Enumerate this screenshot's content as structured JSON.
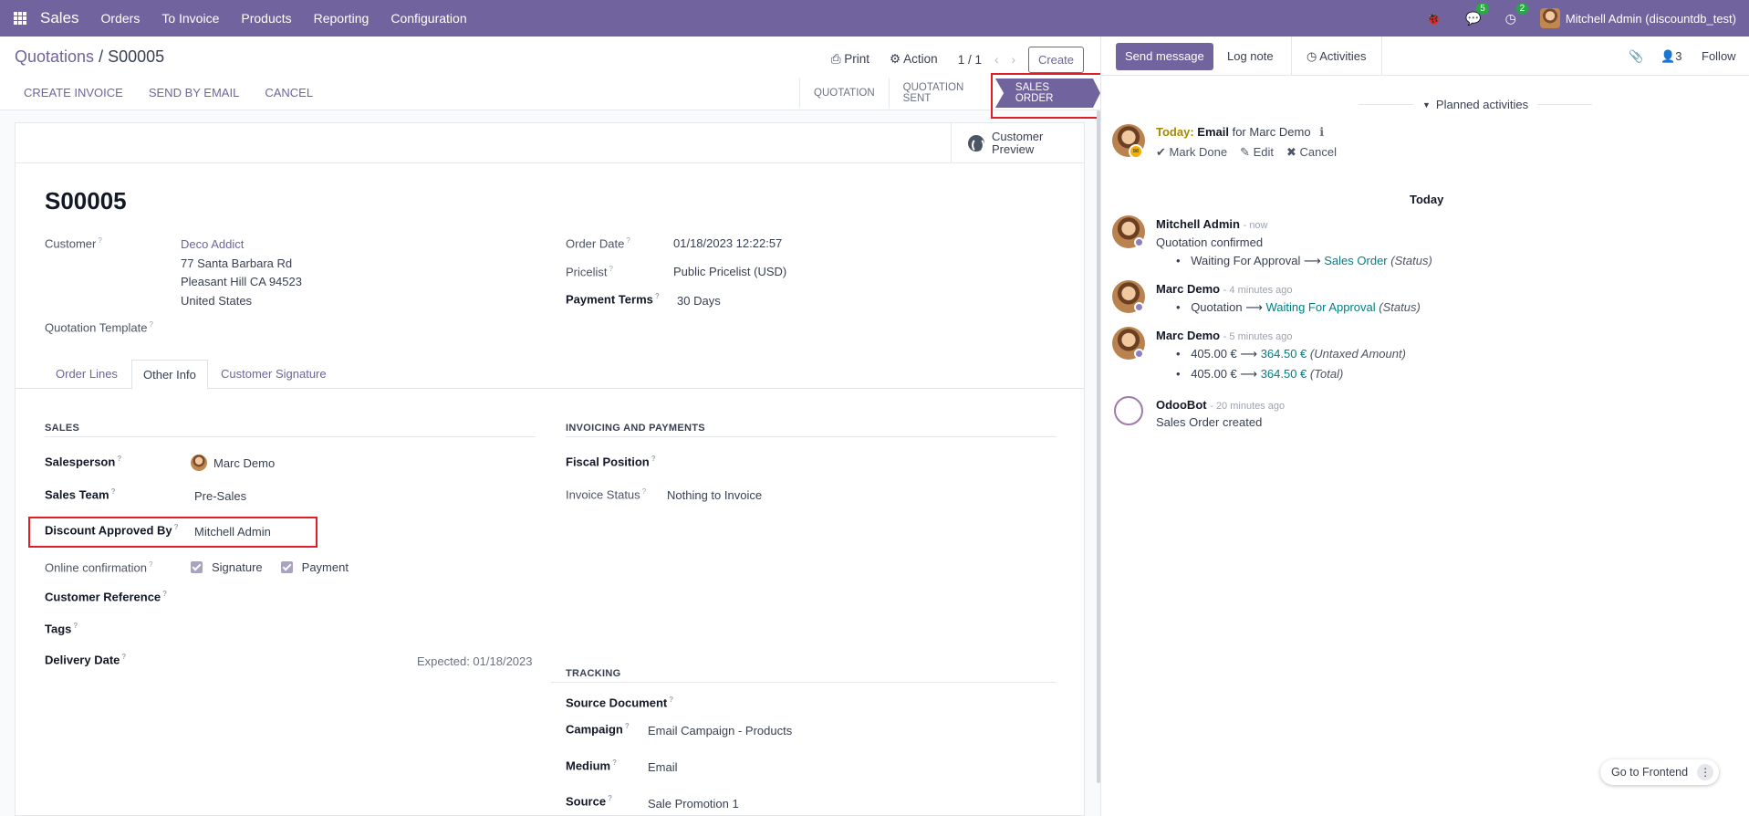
{
  "topnav": {
    "app_name": "Sales",
    "menus": [
      "Orders",
      "To Invoice",
      "Products",
      "Reporting",
      "Configuration"
    ],
    "messages_count": "5",
    "activities_count": "2",
    "user": "Mitchell Admin (discountdb_test)"
  },
  "control_panel": {
    "breadcrumb_parent": "Quotations",
    "breadcrumb_sep": "/",
    "breadcrumb_current": "S00005",
    "print_label": "Print",
    "action_label": "Action",
    "pager": "1 / 1",
    "create_label": "Create",
    "actions": [
      "CREATE INVOICE",
      "SEND BY EMAIL",
      "CANCEL"
    ],
    "status_steps": [
      "QUOTATION",
      "QUOTATION SENT"
    ],
    "status_active": "SALES ORDER"
  },
  "form": {
    "customer_preview": "Customer Preview",
    "order_name": "S00005",
    "customer_label": "Customer",
    "customer_name": "Deco Addict",
    "address_line1": "77 Santa Barbara Rd",
    "address_line2": "Pleasant Hill CA 94523",
    "address_line3": "United States",
    "quotation_template_label": "Quotation Template",
    "order_date_label": "Order Date",
    "order_date": "01/18/2023 12:22:57",
    "pricelist_label": "Pricelist",
    "pricelist": "Public Pricelist (USD)",
    "payment_terms_label": "Payment Terms",
    "payment_terms": "30 Days",
    "tabs": [
      "Order Lines",
      "Other Info",
      "Customer Signature"
    ],
    "sales_section": "SALES",
    "salesperson_label": "Salesperson",
    "salesperson": "Marc Demo",
    "sales_team_label": "Sales Team",
    "sales_team": "Pre-Sales",
    "discount_approved_label": "Discount Approved By",
    "discount_approved": "Mitchell Admin",
    "online_confirmation_label": "Online confirmation",
    "signature_label": "Signature",
    "payment_label": "Payment",
    "customer_reference_label": "Customer Reference",
    "tags_label": "Tags",
    "delivery_date_label": "Delivery Date",
    "delivery_expected": "Expected: 01/18/2023",
    "invoicing_section": "INVOICING AND PAYMENTS",
    "fiscal_position_label": "Fiscal Position",
    "invoice_status_label": "Invoice Status",
    "invoice_status": "Nothing to Invoice",
    "tracking_section": "TRACKING",
    "source_document_label": "Source Document",
    "campaign_label": "Campaign",
    "campaign": "Email Campaign - Products",
    "medium_label": "Medium",
    "medium": "Email",
    "source_label": "Source",
    "source": "Sale Promotion 1",
    "help_mark": "?"
  },
  "chatter": {
    "send_message": "Send message",
    "log_note": "Log note",
    "activities": "Activities",
    "followers_count": "3",
    "follow": "Follow",
    "planned_activities": "Planned activities",
    "activity_today": "Today:",
    "activity_type": "Email",
    "activity_for": "for Marc Demo",
    "mark_done": "Mark Done",
    "edit": "Edit",
    "cancel": "Cancel",
    "date_separator": "Today",
    "messages": [
      {
        "author": "Mitchell Admin",
        "time": "- now",
        "body": "Quotation confirmed",
        "from": "Waiting For Approval",
        "to": "Sales Order",
        "field": "(Status)"
      },
      {
        "author": "Marc Demo",
        "time": "- 4 minutes ago",
        "from": "Quotation",
        "to": "Waiting For Approval",
        "field": "(Status)"
      },
      {
        "author": "Marc Demo",
        "time": "- 5 minutes ago",
        "from": "405.00 €",
        "to": "364.50 €",
        "field": "(Untaxed Amount)",
        "from2": "405.00 €",
        "to2": "364.50 €",
        "field2": "(Total)"
      },
      {
        "author": "OdooBot",
        "time": "- 20 minutes ago",
        "body": "Sales Order created"
      }
    ]
  },
  "footer": {
    "go_to_frontend": "Go to Frontend"
  },
  "colors": {
    "brand": "#71639e",
    "link_teal": "#017e84",
    "highlight": "#e11d2a"
  }
}
